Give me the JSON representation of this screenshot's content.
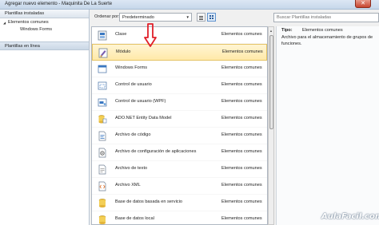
{
  "window": {
    "title": "Agregar nuevo elemento - Maquinita De La Suerte",
    "close_label": "✕"
  },
  "sidebar": {
    "header": "Plantillas instaladas",
    "tree_root": "Elementos comunes",
    "tree_children": [
      "Windows Forms"
    ],
    "online_label": "Plantillas en línea"
  },
  "toolbar": {
    "sort_label": "Ordenar por:",
    "sort_value": "Predeterminado",
    "search_placeholder": "Buscar Plantillas instaladas"
  },
  "templates": [
    {
      "name": "Clase",
      "category": "Elementos comunes",
      "icon": "class-icon"
    },
    {
      "name": "Módulo",
      "category": "Elementos comunes",
      "icon": "module-icon",
      "selected": true
    },
    {
      "name": "Windows Forms",
      "category": "Elementos comunes",
      "icon": "windows-form-icon"
    },
    {
      "name": "Control de usuario",
      "category": "Elementos comunes",
      "icon": "user-control-icon"
    },
    {
      "name": "Control de usuario (WPF)",
      "category": "Elementos comunes",
      "icon": "wpf-user-control-icon"
    },
    {
      "name": "ADO.NET Entity Data Model",
      "category": "Elementos comunes",
      "icon": "entity-model-icon"
    },
    {
      "name": "Archivo de código",
      "category": "Elementos comunes",
      "icon": "code-file-icon"
    },
    {
      "name": "Archivo de configuración de aplicaciones",
      "category": "Elementos comunes",
      "icon": "config-file-icon"
    },
    {
      "name": "Archivo de texto",
      "category": "Elementos comunes",
      "icon": "text-file-icon"
    },
    {
      "name": "Archivo XML",
      "category": "Elementos comunes",
      "icon": "xml-file-icon"
    },
    {
      "name": "Base de datos basada en servicio",
      "category": "Elementos comunes",
      "icon": "service-database-icon"
    },
    {
      "name": "Base de datos local",
      "category": "Elementos comunes",
      "icon": "local-database-icon"
    }
  ],
  "details": {
    "type_label": "Tipo:",
    "type_value": "Elementos comunes",
    "description": "Archivo para el almacenamiento de grupos de funciones."
  },
  "watermark": "AulaFacil.com",
  "colors": {
    "selection": "#ffe9a8",
    "annotation_arrow": "#e0202a",
    "sidebar_selected": "#cbd8e6"
  }
}
